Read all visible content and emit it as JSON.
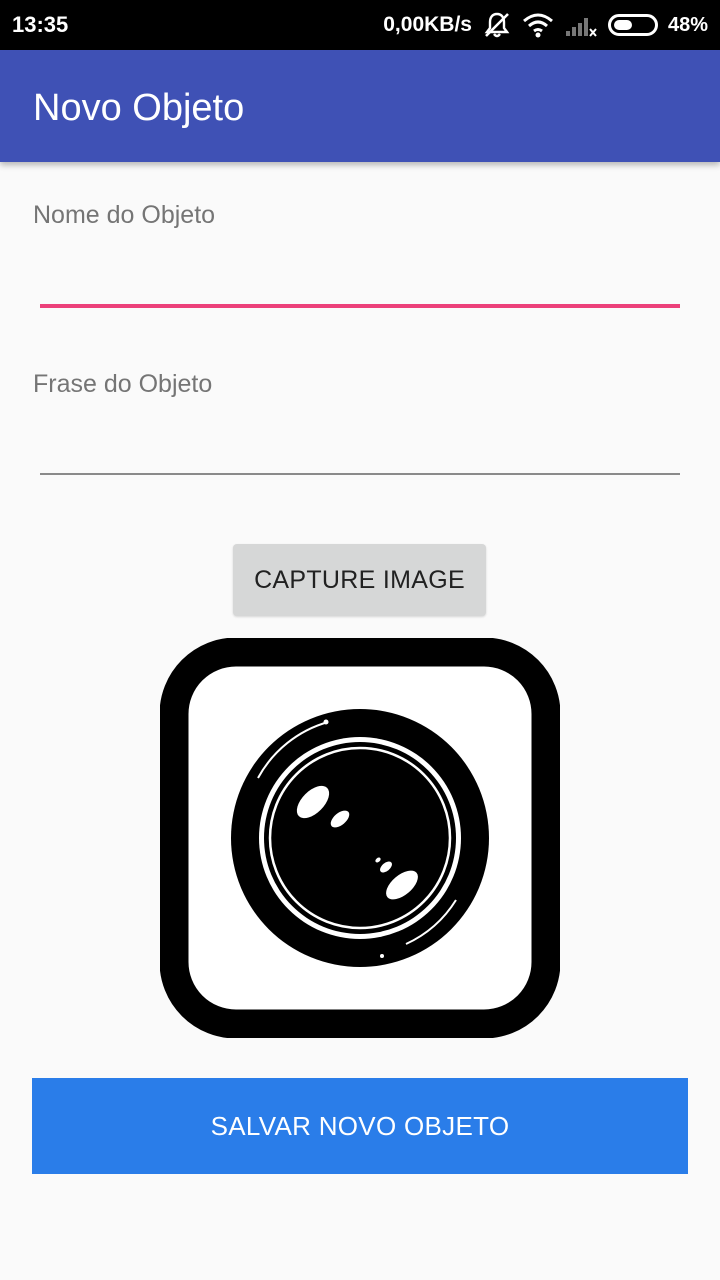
{
  "status_bar": {
    "time": "13:35",
    "network_speed": "0,00KB/s",
    "battery_percent": "48%",
    "battery_level": 0.48,
    "icons": [
      "mute-icon",
      "wifi-icon",
      "signal-icon",
      "battery-icon"
    ]
  },
  "app_bar": {
    "title": "Novo Objeto",
    "color": "#3f51b5"
  },
  "form": {
    "name_field": {
      "label": "Nome do Objeto",
      "value": "",
      "underline_color": "#ec407a"
    },
    "phrase_field": {
      "label": "Frase do Objeto",
      "value": ""
    }
  },
  "capture_button": {
    "label": "CAPTURE IMAGE"
  },
  "preview_image": {
    "icon": "camera-lens-icon"
  },
  "save_button": {
    "label": "SALVAR NOVO OBJETO",
    "color": "#2a7de9"
  }
}
